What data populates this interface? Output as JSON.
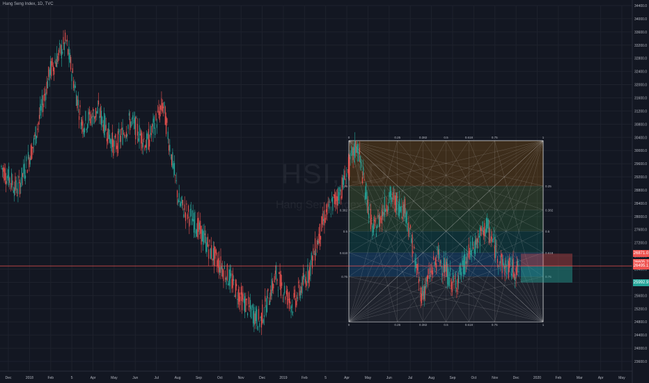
{
  "header": {
    "title": "Hang Seng Index, 1D, TVC"
  },
  "watermark": {
    "symbol": "HSI, 1D",
    "name": "Hang Seng Index"
  },
  "colors": {
    "background": "#131722",
    "grid": "#1e222d",
    "up": "#26a69a",
    "down": "#ef5350",
    "text": "#b2b5be"
  },
  "chart_data": {
    "type": "candlestick",
    "y_axis_ticks": [
      "34400.0",
      "34000.0",
      "33600.0",
      "33200.0",
      "32800.0",
      "32400.0",
      "32000.0",
      "31600.0",
      "31200.0",
      "30800.0",
      "30400.0",
      "30000.0",
      "29600.0",
      "29200.0",
      "28800.0",
      "28400.0",
      "28000.0",
      "27600.0",
      "27200.0",
      "26800.0",
      "26400.0",
      "26000.0",
      "25600.0",
      "25200.0",
      "24800.0",
      "24400.0",
      "24000.0",
      "23600.0"
    ],
    "x_axis_ticks": [
      "Dec",
      "2018",
      "Feb",
      "5",
      "Apr",
      "May",
      "Jun",
      "Jul",
      "Aug",
      "Sep",
      "Oct",
      "Nov",
      "Dec",
      "2019",
      "Feb",
      "5",
      "Apr",
      "May",
      "Jun",
      "Jul",
      "Aug",
      "Sep",
      "Oct",
      "Nov",
      "Dec",
      "2020",
      "Feb",
      "Mar",
      "Apr",
      "May"
    ],
    "ylim": [
      23600,
      34400
    ],
    "price_points": [
      {
        "x": "Nov 2017",
        "y": 29500
      },
      {
        "x": "Dec 2017",
        "y": 28800
      },
      {
        "x": "2018",
        "y": 30200
      },
      {
        "x": "Jan 2018",
        "y": 32400
      },
      {
        "x": "late Jan 2018",
        "y": 33300
      },
      {
        "x": "Feb 2018",
        "y": 30800
      },
      {
        "x": "Mar 2018",
        "y": 31200
      },
      {
        "x": "Apr 2018",
        "y": 30100
      },
      {
        "x": "May 2018",
        "y": 30900
      },
      {
        "x": "Jun 2018",
        "y": 30200
      },
      {
        "x": "Jun 2018",
        "y": 31400
      },
      {
        "x": "Jul 2018",
        "y": 28400
      },
      {
        "x": "Aug 2018",
        "y": 27800
      },
      {
        "x": "Sep 2018",
        "y": 26900
      },
      {
        "x": "Oct 2018",
        "y": 26200
      },
      {
        "x": "Oct 2018",
        "y": 25400
      },
      {
        "x": "Nov 2018",
        "y": 24800
      },
      {
        "x": "Dec 2018",
        "y": 26200
      },
      {
        "x": "Dec 2018",
        "y": 25300
      },
      {
        "x": "2019",
        "y": 26300
      },
      {
        "x": "Feb 2019",
        "y": 28000
      },
      {
        "x": "Mar 2019",
        "y": 28800
      },
      {
        "x": "Apr 2019",
        "y": 30200
      },
      {
        "x": "May 2019",
        "y": 27500
      },
      {
        "x": "Jun 2019",
        "y": 28600
      },
      {
        "x": "Jul 2019",
        "y": 28200
      },
      {
        "x": "Aug 2019",
        "y": 25600
      },
      {
        "x": "Sep 2019",
        "y": 26800
      },
      {
        "x": "Oct 2019",
        "y": 25900
      },
      {
        "x": "Oct 2019",
        "y": 26900
      },
      {
        "x": "Nov 2019",
        "y": 27700
      },
      {
        "x": "Nov 2019",
        "y": 26500
      },
      {
        "x": "Dec 2019",
        "y": 26350
      }
    ],
    "gann_box": {
      "top_price": 30300,
      "bottom_price": 24800,
      "levels": [
        {
          "label": "0.25",
          "ratio": 0.25
        },
        {
          "label": "0.382",
          "ratio": 0.382
        },
        {
          "label": "0.5",
          "ratio": 0.5
        },
        {
          "label": "0.618",
          "ratio": 0.618
        },
        {
          "label": "0.75",
          "ratio": 0.75
        }
      ],
      "corner_labels": [
        "0",
        "1"
      ]
    },
    "price_badges": [
      {
        "label": "26871.0",
        "color": "#ef5350"
      },
      {
        "label": "26605.2",
        "color": "#ef5350"
      },
      {
        "label": "26495.1",
        "color": "#ef5350"
      },
      {
        "label": "25992.9",
        "color": "#26a69a"
      }
    ],
    "horizontal_line": {
      "price": 26495.1,
      "color": "#ef5350"
    }
  }
}
